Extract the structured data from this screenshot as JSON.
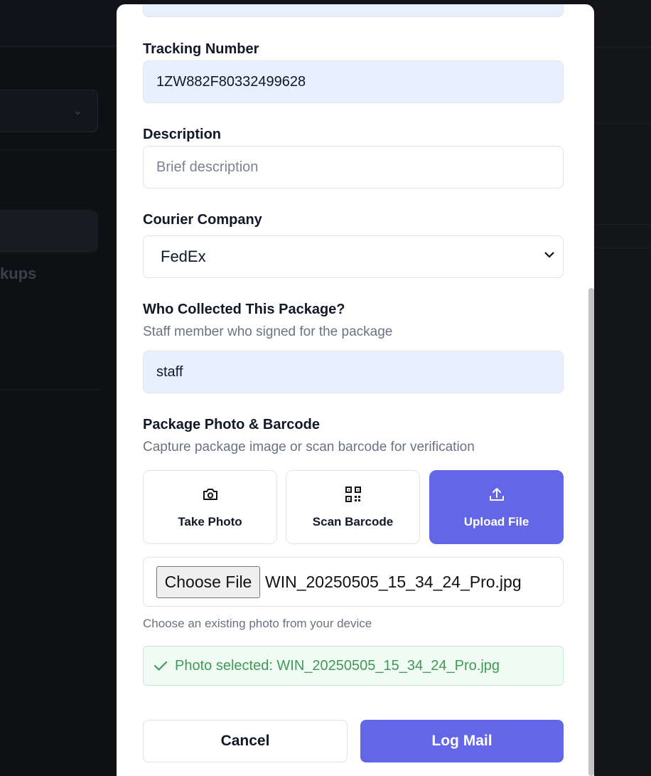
{
  "background": {
    "partial_label": "kups"
  },
  "form": {
    "tracking": {
      "label": "Tracking Number",
      "value": "1ZW882F80332499628"
    },
    "description": {
      "label": "Description",
      "placeholder": "Brief description"
    },
    "courier": {
      "label": "Courier Company",
      "selected": "FedEx"
    },
    "collected": {
      "label": "Who Collected This Package?",
      "help": "Staff member who signed for the package",
      "value": "staff"
    },
    "photo": {
      "label": "Package Photo & Barcode",
      "help": "Capture package image or scan barcode for verification",
      "options": [
        {
          "label": "Take Photo",
          "icon": "camera-icon"
        },
        {
          "label": "Scan Barcode",
          "icon": "qr-code-icon"
        },
        {
          "label": "Upload File",
          "icon": "upload-icon",
          "active": true
        }
      ],
      "choose_file_label": "Choose File",
      "file_name": "WIN_20250505_15_34_24_Pro.jpg",
      "file_help": "Choose an existing photo from your device",
      "success_message": "Photo selected: WIN_20250505_15_34_24_Pro.jpg"
    }
  },
  "actions": {
    "cancel_label": "Cancel",
    "submit_label": "Log Mail"
  },
  "colors": {
    "accent": "#6366e6",
    "success_text": "#3f9a57",
    "filled_input": "#e8f0fe"
  }
}
